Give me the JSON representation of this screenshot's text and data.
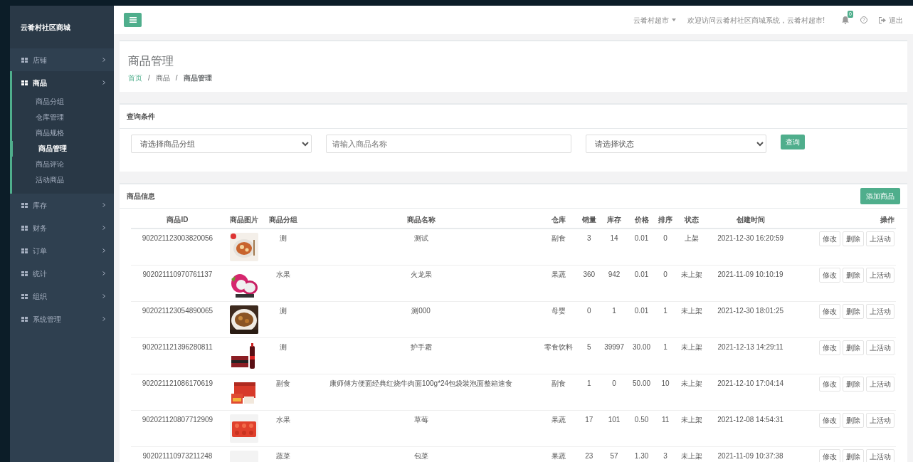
{
  "sidebar": {
    "brand": "云肴村社区商城",
    "items": [
      {
        "label": "店铺",
        "expanded": false
      },
      {
        "label": "商品",
        "expanded": true,
        "children": [
          {
            "label": "商品分组",
            "selected": false
          },
          {
            "label": "仓库管理",
            "selected": false
          },
          {
            "label": "商品规格",
            "selected": false
          },
          {
            "label": "商品管理",
            "selected": true
          },
          {
            "label": "商品评论",
            "selected": false
          },
          {
            "label": "活动商品",
            "selected": false
          }
        ]
      },
      {
        "label": "库存",
        "expanded": false
      },
      {
        "label": "财务",
        "expanded": false
      },
      {
        "label": "订单",
        "expanded": false
      },
      {
        "label": "统计",
        "expanded": false
      },
      {
        "label": "组织",
        "expanded": false
      },
      {
        "label": "系统管理",
        "expanded": false
      }
    ]
  },
  "topbar": {
    "user": "云肴村超市",
    "welcome": "欢迎访问云肴村社区商城系统，云肴村超市!",
    "notifications": "0",
    "help": "?",
    "logout": "退出"
  },
  "page": {
    "title": "商品管理",
    "breadcrumb": [
      {
        "kind": "link",
        "text": "首页"
      },
      {
        "kind": "separator",
        "text": "/"
      },
      {
        "kind": "link",
        "text": "商品"
      },
      {
        "kind": "separator",
        "text": "/"
      },
      {
        "kind": "current",
        "text": "商品管理"
      }
    ]
  },
  "query": {
    "title": "查询条件",
    "group_placeholder": "请选择商品分组",
    "name_placeholder": "请输入商品名称",
    "status_placeholder": "请选择状态",
    "button": "查询"
  },
  "products": {
    "title": "商品信息",
    "add_button": "添加商品",
    "columns": [
      "商品ID",
      "商品图片",
      "商品分组",
      "商品名称",
      "仓库",
      "销量",
      "库存",
      "价格",
      "排序",
      "状态",
      "创建时间",
      "操作"
    ],
    "rows": [
      {
        "id": "902021123003820056",
        "group": "测",
        "name": "测试",
        "warehouse": "副食",
        "sales": "3",
        "stock": "14",
        "price": "0.01",
        "sort": "0",
        "status": "上架",
        "created": "2021-12-30 16:20:59",
        "actions": [
          "修改",
          "删除",
          "上活动"
        ]
      },
      {
        "id": "902021110970761137",
        "group": "水果",
        "name": "火龙果",
        "warehouse": "果蔬",
        "sales": "360",
        "stock": "942",
        "price": "0.01",
        "sort": "0",
        "status": "未上架",
        "created": "2021-11-09 10:10:19",
        "actions": [
          "修改",
          "删除",
          "上活动"
        ]
      },
      {
        "id": "902021123054890065",
        "group": "测",
        "name": "测000",
        "warehouse": "母婴",
        "sales": "0",
        "stock": "1",
        "price": "0.01",
        "sort": "1",
        "status": "未上架",
        "created": "2021-12-30 18:01:25",
        "actions": [
          "修改",
          "删除",
          "上活动"
        ]
      },
      {
        "id": "902021121396280811",
        "group": "测",
        "name": "护手霜",
        "warehouse": "零食饮料",
        "sales": "5",
        "stock": "39997",
        "price": "30.00",
        "sort": "1",
        "status": "未上架",
        "created": "2021-12-13 14:29:11",
        "actions": [
          "修改",
          "删除",
          "上活动"
        ]
      },
      {
        "id": "902021121086170619",
        "group": "副食",
        "name": "康师傅方便面经典红烧牛肉面100g*24包袋装泡面整箱速食",
        "warehouse": "副食",
        "sales": "1",
        "stock": "0",
        "price": "50.00",
        "sort": "10",
        "status": "未上架",
        "created": "2021-12-10 17:04:14",
        "actions": [
          "修改",
          "删除",
          "上活动"
        ]
      },
      {
        "id": "902021120807712909",
        "group": "水果",
        "name": "草莓",
        "warehouse": "果蔬",
        "sales": "17",
        "stock": "101",
        "price": "0.50",
        "sort": "11",
        "status": "未上架",
        "created": "2021-12-08 14:54:31",
        "actions": [
          "修改",
          "删除",
          "上活动"
        ]
      },
      {
        "id": "902021110973211248",
        "group": "蔬菜",
        "name": "包菜",
        "warehouse": "果蔬",
        "sales": "23",
        "stock": "57",
        "price": "1.30",
        "sort": "3",
        "status": "未上架",
        "created": "2021-11-09 10:37:38",
        "actions": [
          "修改",
          "删除",
          "上活动"
        ]
      }
    ]
  }
}
